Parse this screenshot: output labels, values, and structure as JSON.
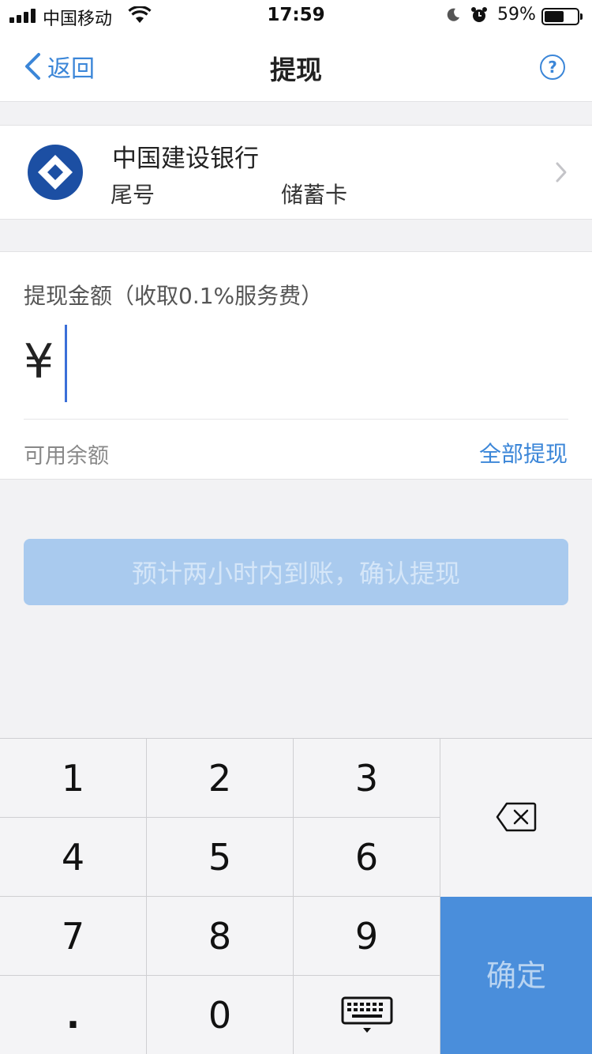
{
  "status_bar": {
    "carrier": "中国移动",
    "time": "17:59",
    "battery_percent": "59%"
  },
  "nav": {
    "back_label": "返回",
    "title": "提现",
    "help_glyph": "?"
  },
  "bank": {
    "name": "中国建设银行",
    "card_prefix": "尾号",
    "card_type": "储蓄卡"
  },
  "amount": {
    "label": "提现金额（收取0.1%服务费）",
    "currency_symbol": "¥",
    "value": "",
    "balance_label": "可用余额",
    "withdraw_all": "全部提现"
  },
  "confirm_button": {
    "label": "预计两小时内到账，确认提现"
  },
  "keypad": {
    "keys": [
      "1",
      "2",
      "3",
      "4",
      "5",
      "6",
      "7",
      "8",
      "9",
      ".",
      "0"
    ],
    "ok_label": "确定"
  },
  "colors": {
    "accent": "#3b86d8",
    "confirm_disabled": "#a9caee",
    "keypad_ok": "#4a8edb"
  },
  "icons": {
    "back": "chevron-left-icon",
    "help": "question-circle-icon",
    "bank_logo": "ccb-logo-icon",
    "chevron": "chevron-right-icon",
    "delete": "backspace-icon",
    "hide_keyboard": "keyboard-hide-icon"
  }
}
